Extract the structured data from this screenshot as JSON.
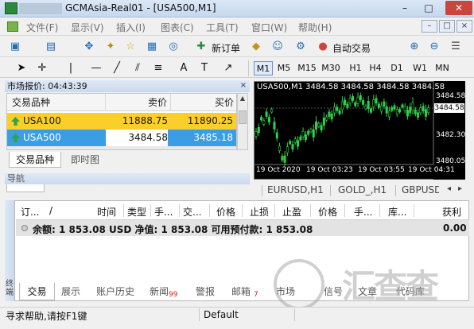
{
  "window": {
    "title": "GCMAsia-Real01 - [USA500,M1]",
    "controls": [
      "–",
      "□",
      "✕"
    ]
  },
  "menu": {
    "items": [
      "文件(F)",
      "显示(V)",
      "插入(I)",
      "图表(C)",
      "工具(T)",
      "窗口(W)",
      "帮助(H)"
    ],
    "mdi_controls": [
      "–",
      "□",
      "×"
    ]
  },
  "toolbar": {
    "new_order_label": "新订单",
    "auto_trading_label": "自动交易",
    "timeframes": [
      "M1",
      "M5",
      "M15",
      "M30",
      "H1",
      "H4",
      "D1",
      "W1",
      "MN"
    ],
    "active_timeframe": "M1"
  },
  "market_watch": {
    "title": "市场报价: 04:43:39",
    "close_glyph": "×",
    "columns": [
      "交易品种",
      "卖价",
      "买价"
    ],
    "rows": [
      {
        "symbol": "USA100",
        "bid": "11888.75",
        "ask": "11890.25",
        "highlight": "#fbcf2b"
      },
      {
        "symbol": "USA500",
        "bid": "3484.58",
        "ask": "3485.18",
        "highlight": "#3a9ee5"
      }
    ],
    "tabs": [
      "交易品种",
      "即时图"
    ]
  },
  "navigator": {
    "title": "导航"
  },
  "chart": {
    "title": "USA500,M1  3484.58 3484.58 3484.58 3484.58",
    "prices": [
      "3484.58",
      "3482.30",
      "3480.05"
    ],
    "current_price": "3484.58",
    "dates": [
      "19 Oct 2020",
      "19 Oct 03:23",
      "19 Oct 03:55",
      "19 Oct 04:31"
    ],
    "background": "#000000",
    "candle_color": "#2fd14a",
    "tabs": [
      "EURUSD,H1",
      "GOLD_,H1",
      "GBPUSD"
    ]
  },
  "terminal": {
    "side_label": "终端",
    "columns": [
      "订...",
      "/",
      "时间",
      "类型",
      "手...",
      "交...",
      "价格",
      "止损",
      "止盈",
      "价格",
      "手...",
      "库...",
      "获利"
    ],
    "balance_line": "余额: 1 853.08 USD  净值: 1 853.08  可用预付款: 1 853.08",
    "balance_total": "0.00",
    "tabs": [
      {
        "label": "交易",
        "badge": ""
      },
      {
        "label": "展示",
        "badge": ""
      },
      {
        "label": "账户历史",
        "badge": ""
      },
      {
        "label": "新闻",
        "badge": "99"
      },
      {
        "label": "警报",
        "badge": ""
      },
      {
        "label": "邮箱",
        "badge": "7"
      },
      {
        "label": "市场",
        "badge": ""
      },
      {
        "label": "信号",
        "badge": ""
      },
      {
        "label": "文章",
        "badge": ""
      },
      {
        "label": "代码库",
        "badge": ""
      }
    ]
  },
  "status": {
    "help": "寻求帮助,请按F1键",
    "profile": "Default"
  },
  "watermark": "汇查查"
}
